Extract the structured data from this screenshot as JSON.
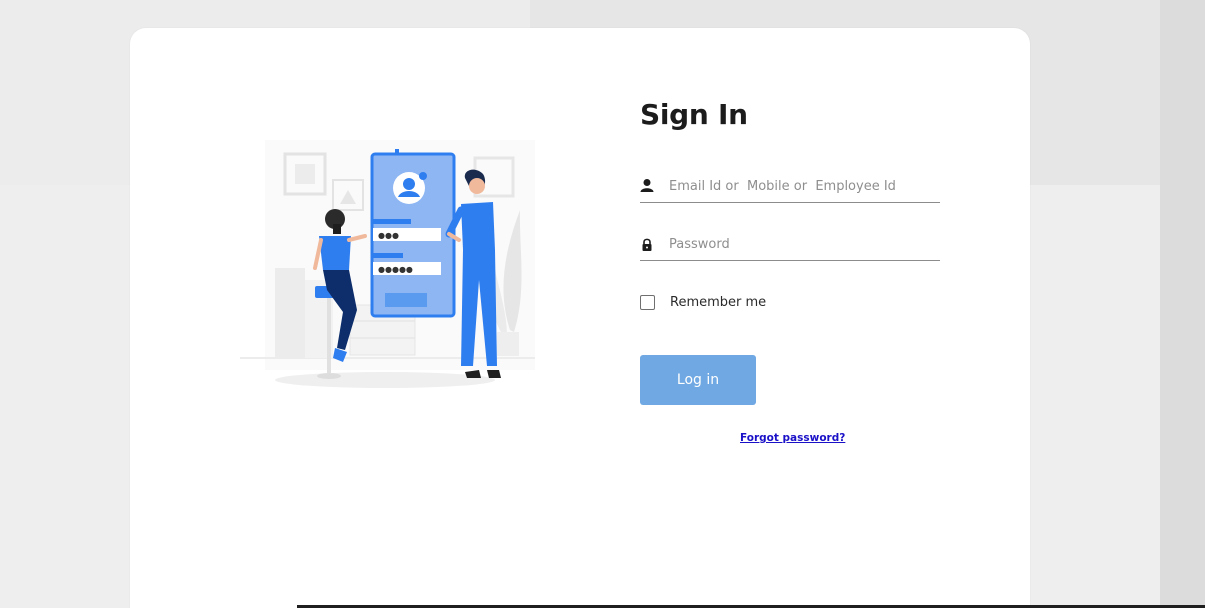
{
  "page": {
    "title": "Sign In"
  },
  "form": {
    "email": {
      "icon": "person-icon",
      "placeholder": "Email Id or  Mobile or  Employee Id",
      "value": ""
    },
    "password": {
      "icon": "lock-icon",
      "placeholder": "Password",
      "value": ""
    },
    "remember_label": "Remember me",
    "remember_checked": false,
    "login_label": "Log in",
    "forgot_label": "Forgot password?"
  },
  "illustration": {
    "name": "login-illustration",
    "password_dots_1": "●●●",
    "password_dots_2": "●●●●●"
  },
  "colors": {
    "accent": "#1f7cf2",
    "button": "#6fa8e2",
    "link": "#1a10c8",
    "card": "#ffffff",
    "background": "#e9e9e9"
  }
}
